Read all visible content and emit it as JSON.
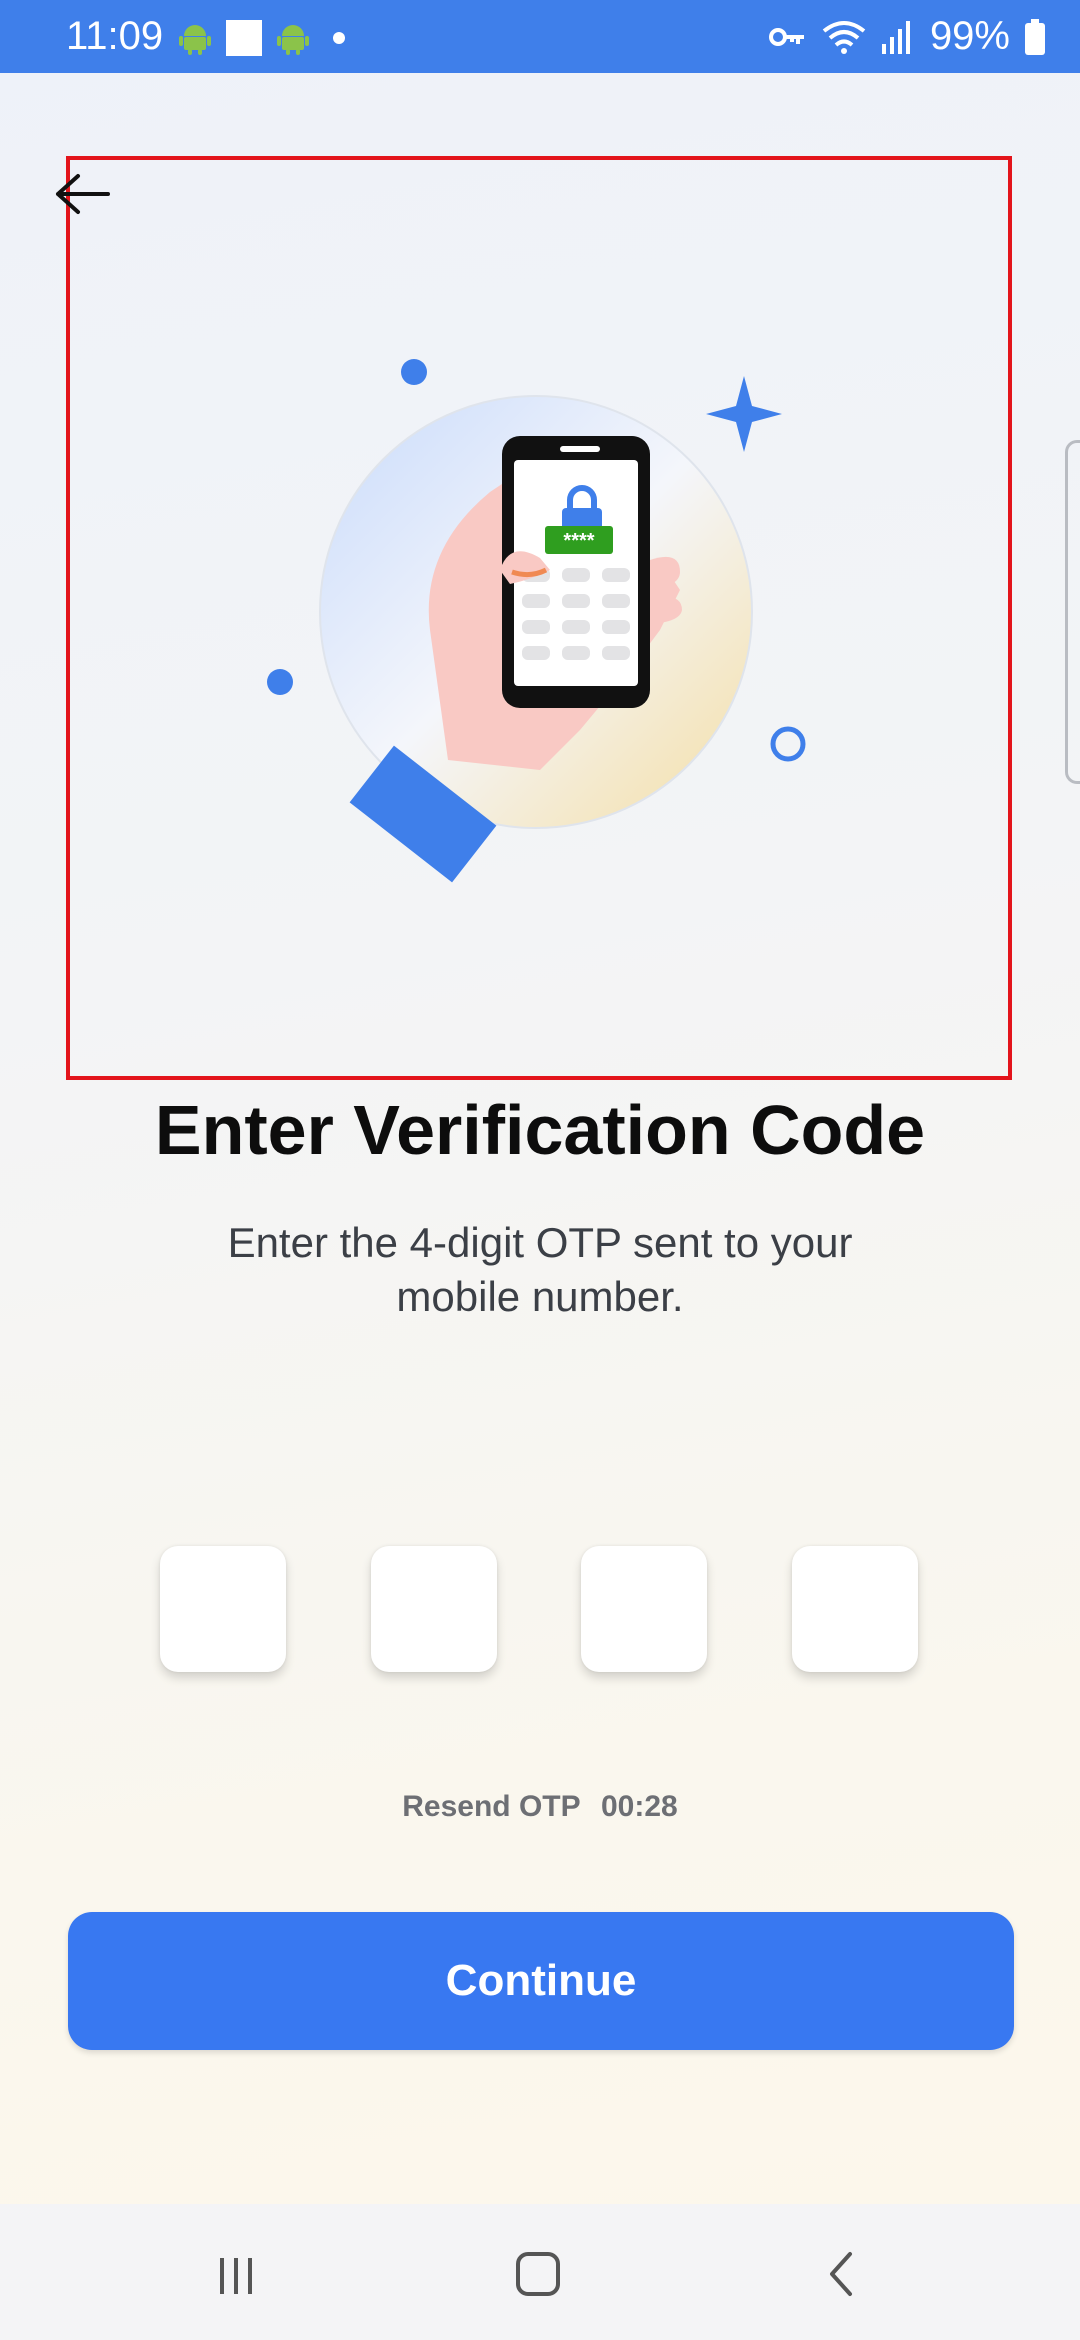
{
  "status_bar": {
    "time": "11:09",
    "battery": "99%",
    "icons": [
      "android-icon",
      "square-icon",
      "android-icon",
      "dot-icon",
      "vpn-key-icon",
      "wifi-icon",
      "signal-icon",
      "battery-icon"
    ]
  },
  "header": {
    "back_icon": "arrow-left-icon"
  },
  "illustration": {
    "lock_code": "****",
    "description_icon": "phone-lock-illustration"
  },
  "main": {
    "title": "Enter Verification Code",
    "subtitle": "Enter the 4-digit OTP sent to your mobile number.",
    "otp_fields": [
      "",
      "",
      "",
      ""
    ],
    "resend_label": "Resend OTP",
    "resend_timer": "00:28",
    "continue_label": "Continue"
  },
  "colors": {
    "status_bar": "#3f7fea",
    "primary_button": "#3878f1",
    "highlight_border": "#e3141b",
    "title_text": "#0d0d0d"
  },
  "nav": {
    "items": [
      "recent-apps-icon",
      "home-icon",
      "back-icon"
    ]
  }
}
